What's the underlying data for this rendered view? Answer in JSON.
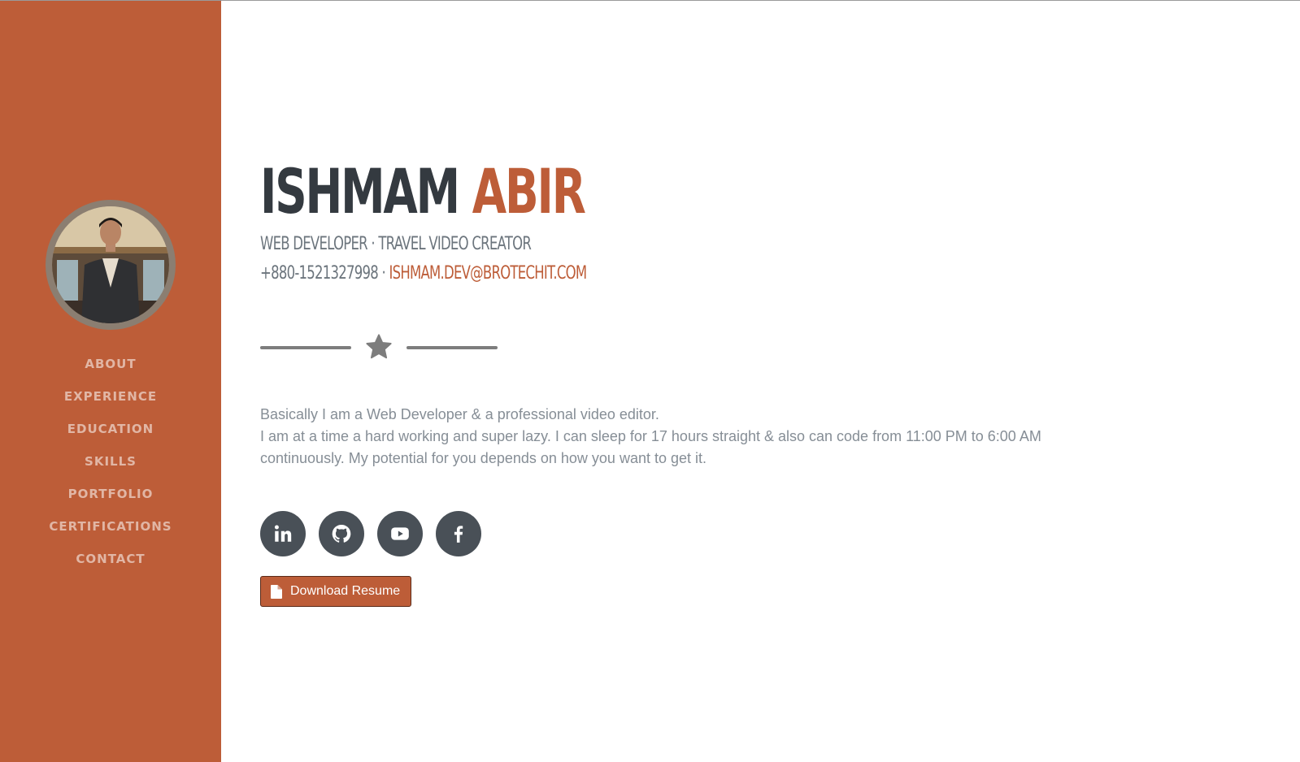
{
  "profile": {
    "first_name": "ISHMAM",
    "last_name": "ABIR",
    "subheading": "WEB DEVELOPER · TRAVEL VIDEO CREATOR",
    "phone": "+880-1521327998 ·",
    "email": "ISHMAM.DEV@BROTECHIT.COM"
  },
  "sidebar": {
    "items": [
      {
        "label": "ABOUT"
      },
      {
        "label": "EXPERIENCE"
      },
      {
        "label": "EDUCATION"
      },
      {
        "label": "SKILLS"
      },
      {
        "label": "PORTFOLIO"
      },
      {
        "label": "CERTIFICATIONS"
      },
      {
        "label": "CONTACT"
      }
    ]
  },
  "about": {
    "line1": "Basically I am a Web Developer & a professional video editor.",
    "line2": "I am at a time a hard working and super lazy. I can sleep for 17 hours straight & also can code from 11:00 PM to 6:00 AM continuously. My potential for you depends on how you want to get it."
  },
  "socials": [
    {
      "icon": "linkedin-icon"
    },
    {
      "icon": "github-icon"
    },
    {
      "icon": "youtube-icon"
    },
    {
      "icon": "facebook-icon"
    }
  ],
  "resume_button": {
    "label": "Download Resume",
    "icon": "file-icon"
  },
  "colors": {
    "accent": "#bd5d38",
    "dark": "#343a40",
    "muted": "#868e96",
    "social_bg": "#495057"
  }
}
